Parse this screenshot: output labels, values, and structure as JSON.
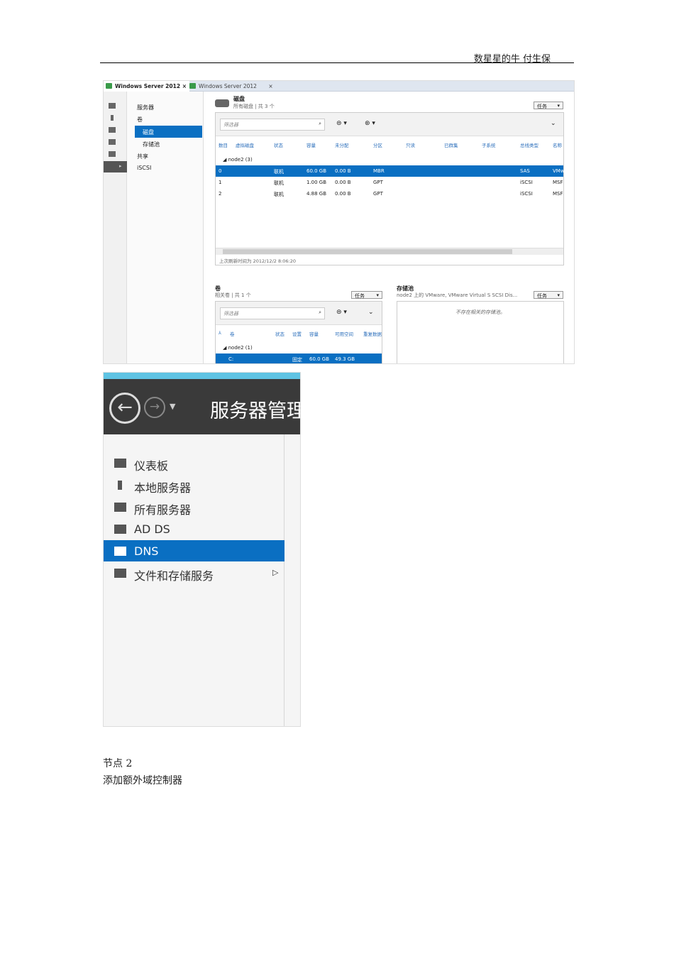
{
  "doc": {
    "header": "数星星的牛  付生保",
    "line1": "节点 2",
    "line2": "添加额外域控制器"
  },
  "shot1": {
    "tabs": [
      "Windows Server 2012",
      "Windows Server 2012"
    ],
    "nav": [
      "服务器",
      "卷",
      "磁盘",
      "存储池",
      "共享",
      "iSCSI"
    ],
    "disks": {
      "title": "磁盘",
      "subtitle": "所有磁盘 | 共 3 个",
      "task": "任务",
      "filter": "筛选器",
      "columns": [
        "数目",
        "虚拟磁盘",
        "状态",
        "容量",
        "未分配",
        "分区",
        "只读",
        "已群集",
        "子系统",
        "总线类型",
        "名称"
      ],
      "group": "node2 (3)",
      "rows": [
        [
          "0",
          "",
          "联机",
          "60.0 GB",
          "0.00 B",
          "MBR",
          "",
          "",
          "",
          "SAS",
          "VMw"
        ],
        [
          "1",
          "",
          "联机",
          "1.00 GB",
          "0.00 B",
          "GPT",
          "",
          "",
          "",
          "iSCSI",
          "MSF"
        ],
        [
          "2",
          "",
          "联机",
          "4.88 GB",
          "0.00 B",
          "GPT",
          "",
          "",
          "",
          "iSCSI",
          "MSF"
        ]
      ],
      "refresh": "上次刷新时间为 2012/12/2 8:06:20"
    },
    "volumes": {
      "title": "卷",
      "subtitle": "相关卷 | 共 1 个",
      "task": "任务",
      "filter": "筛选器",
      "columns": [
        "卷",
        "状态",
        "设置",
        "容量",
        "可用空间",
        "重复数据"
      ],
      "group": "node2 (1)",
      "rows": [
        [
          "C:",
          "",
          "固定",
          "60.0 GB",
          "49.3 GB",
          ""
        ]
      ]
    },
    "pool": {
      "title": "存储池",
      "subtitle": "node2 上的 VMware, VMware Virtual S SCSI Dis...",
      "task": "任务",
      "empty": "不存在相关的存储池。"
    }
  },
  "shot2": {
    "title": "服务器管理",
    "nav": [
      "仪表板",
      "本地服务器",
      "所有服务器",
      "AD DS",
      "DNS",
      "文件和存储服务"
    ],
    "selected": "DNS",
    "accent": "#0a6fc2"
  }
}
